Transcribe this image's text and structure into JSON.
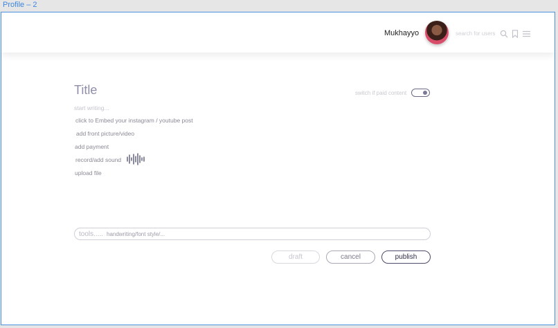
{
  "window": {
    "title": "Profile – 2"
  },
  "header": {
    "username": "Mukhayyo",
    "search_placeholder": "search for users",
    "icons": [
      "search-icon",
      "bookmark-icon",
      "menu-icon"
    ]
  },
  "editor": {
    "title": "Title",
    "paid_toggle_label": "switch if paid content",
    "paid_toggle_on": true,
    "placeholder": "start writing...",
    "options": {
      "embed": "click to Embed your instagram / youtube post",
      "front_picture": "add front picture/video",
      "payment": "add payment",
      "sound": "record/add sound",
      "upload": "upload file"
    }
  },
  "toolsbar": {
    "label": "tools.....",
    "hint": "handwriting/font style/..."
  },
  "actions": {
    "draft": "draft",
    "cancel": "cancel",
    "publish": "publish"
  },
  "colors": {
    "frame_border": "#4a90e2",
    "accent": "#4a4a6a",
    "muted_text": "#8a8a96"
  }
}
